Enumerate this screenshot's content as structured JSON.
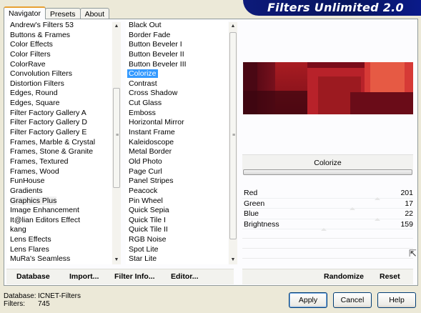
{
  "tabs": [
    {
      "label": "Navigator"
    },
    {
      "label": "Presets"
    },
    {
      "label": "About"
    }
  ],
  "banner": {
    "title": "Filters Unlimited 2.0"
  },
  "categories": [
    "Andrew's Filters 53",
    "Buttons & Frames",
    "Color Effects",
    "Color Filters",
    "ColorRave",
    "Convolution Filters",
    "Distortion Filters",
    "Edges, Round",
    "Edges, Square",
    "Filter Factory Gallery A",
    "Filter Factory Gallery D",
    "Filter Factory Gallery E",
    "Frames, Marble & Crystal",
    "Frames, Stone & Granite",
    "Frames, Textured",
    "Frames, Wood",
    "FunHouse",
    "Gradients",
    "Graphics Plus",
    "Image Enhancement",
    "It@lian Editors Effect",
    "kang",
    "Lens Effects",
    "Lens Flares",
    "MuRa's Seamless"
  ],
  "filters": [
    "Black Out",
    "Border Fade",
    "Button Beveler I",
    "Button Beveler II",
    "Button Beveler III",
    "Colorize",
    "Contrast",
    "Cross Shadow",
    "Cut Glass",
    "Emboss",
    "Horizontal Mirror",
    "Instant Frame",
    "Kaleidoscope",
    "Metal Border",
    "Old Photo",
    "Page Curl",
    "Panel Stripes",
    "Peacock",
    "Pin Wheel",
    "Quick Sepia",
    "Quick Tile I",
    "Quick Tile II",
    "RGB Noise",
    "Spot Lite",
    "Star Lite"
  ],
  "selected_category": "Graphics Plus",
  "selected_filter": "Colorize",
  "filter_name": "Colorize",
  "params": [
    {
      "label": "Red",
      "value": "201"
    },
    {
      "label": "Green",
      "value": "17"
    },
    {
      "label": "Blue",
      "value": "22"
    },
    {
      "label": "Brightness",
      "value": "159"
    }
  ],
  "left_buttons": {
    "database": "Database",
    "import": "Import...",
    "filter_info": "Filter Info...",
    "editor": "Editor..."
  },
  "right_buttons": {
    "randomize": "Randomize",
    "reset": "Reset"
  },
  "info": {
    "database_label": "Database:",
    "database_value": "ICNET-Filters",
    "filters_label": "Filters:",
    "filters_value": "745"
  },
  "dialog_buttons": {
    "apply": "Apply",
    "cancel": "Cancel",
    "help": "Help"
  },
  "colors": {
    "banner": "#0d1a7a",
    "selection": "#3399ff",
    "preview_base": "#7a0c1a"
  }
}
